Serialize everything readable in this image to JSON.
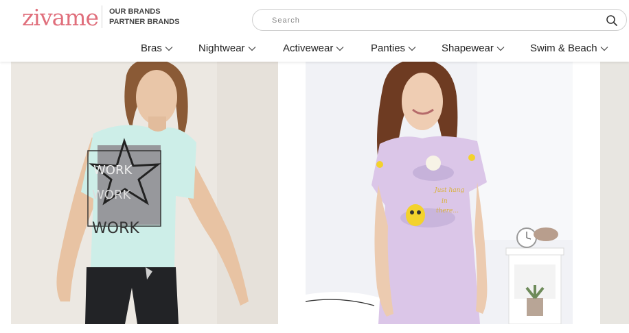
{
  "header": {
    "logo": "zivame",
    "brand_links": [
      "OUR BRANDS",
      "PARTNER BRANDS"
    ],
    "search": {
      "placeholder": "Search"
    }
  },
  "nav": {
    "items": [
      "Bras",
      "Nightwear",
      "Activewear",
      "Panties",
      "Shapewear",
      "Swim & Beach"
    ]
  },
  "products": [
    {
      "image": "woman-in-mint-graphic-tee"
    },
    {
      "image": "woman-in-lilac-printed-nightdress"
    },
    {
      "image": "partial-product-image"
    }
  ],
  "colors": {
    "brand": "#e06f7c",
    "text": "#222222"
  }
}
